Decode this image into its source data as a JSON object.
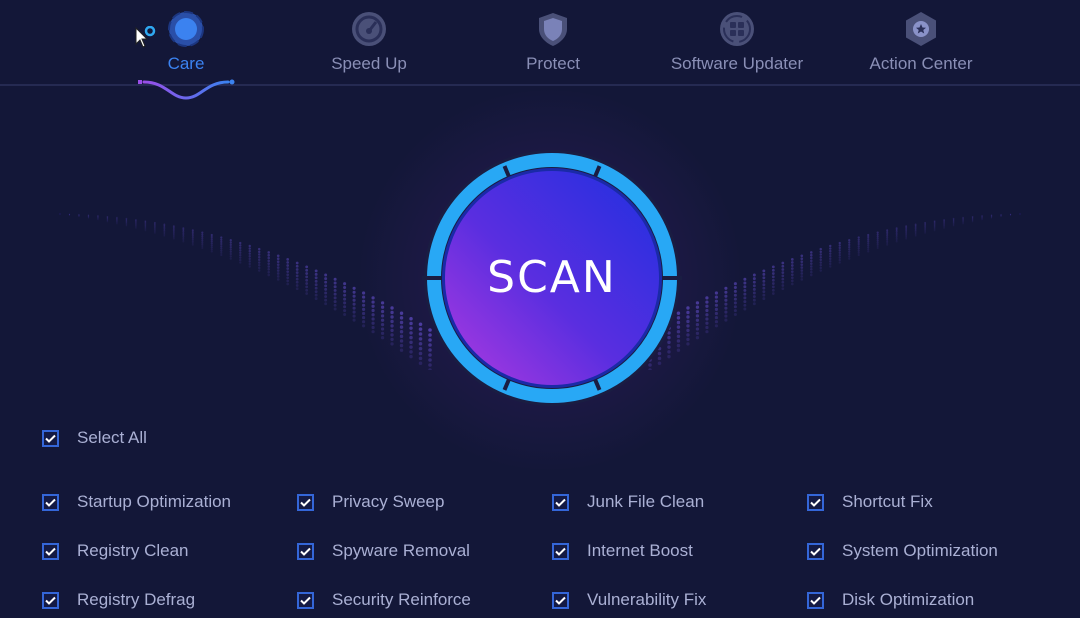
{
  "nav": {
    "tabs": [
      {
        "label": "Care",
        "icon": "care-icon",
        "active": true
      },
      {
        "label": "Speed Up",
        "icon": "speedometer-icon",
        "active": false
      },
      {
        "label": "Protect",
        "icon": "shield-icon",
        "active": false
      },
      {
        "label": "Software Updater",
        "icon": "software-update-icon",
        "active": false
      },
      {
        "label": "Action Center",
        "icon": "action-center-icon",
        "active": false
      }
    ]
  },
  "scan": {
    "label": "SCAN"
  },
  "select_all": {
    "label": "Select All",
    "checked": true
  },
  "options": [
    {
      "label": "Startup Optimization",
      "checked": true
    },
    {
      "label": "Privacy Sweep",
      "checked": true
    },
    {
      "label": "Junk File Clean",
      "checked": true
    },
    {
      "label": "Shortcut Fix",
      "checked": true
    },
    {
      "label": "Registry Clean",
      "checked": true
    },
    {
      "label": "Spyware Removal",
      "checked": true
    },
    {
      "label": "Internet Boost",
      "checked": true
    },
    {
      "label": "System Optimization",
      "checked": true
    },
    {
      "label": "Registry Defrag",
      "checked": true
    },
    {
      "label": "Security Reinforce",
      "checked": true
    },
    {
      "label": "Vulnerability Fix",
      "checked": true
    },
    {
      "label": "Disk Optimization",
      "checked": true
    }
  ],
  "colors": {
    "accent": "#3b82f0",
    "ring": "#28a8f5",
    "background": "#131738"
  }
}
